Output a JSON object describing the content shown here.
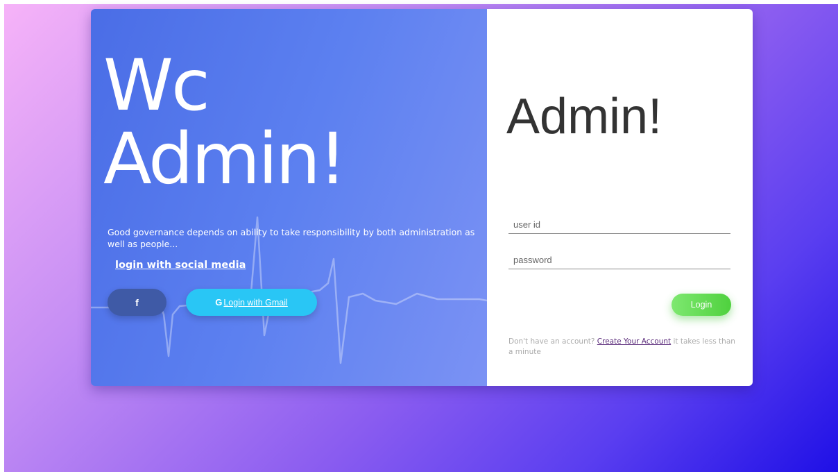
{
  "hero": {
    "title_line1": "Wc",
    "title_line2": "Admin!",
    "tagline": "Good governance depends on ability to take responsibility by both administration as well as people...",
    "social_link": "login with social media",
    "facebook_icon": "f",
    "gmail_icon": "G",
    "gmail_label": " Login with Gmail"
  },
  "login": {
    "title": "Admin!",
    "userid_placeholder": "user id",
    "password_placeholder": "password",
    "button_label": "Login",
    "signup_prefix": "Don't have an account? ",
    "signup_link": "Create Your Account",
    "signup_suffix": " it takes less than a minute"
  },
  "colors": {
    "left_panel": "#5c80f0",
    "facebook_button": "#3f5aa6",
    "gmail_button": "#29c6f5",
    "login_button": "#5ad64a",
    "signup_link": "#5a2a7a"
  },
  "icons": {
    "facebook": "facebook-icon",
    "gmail": "google-icon",
    "heartbeat": "heartbeat-line"
  }
}
